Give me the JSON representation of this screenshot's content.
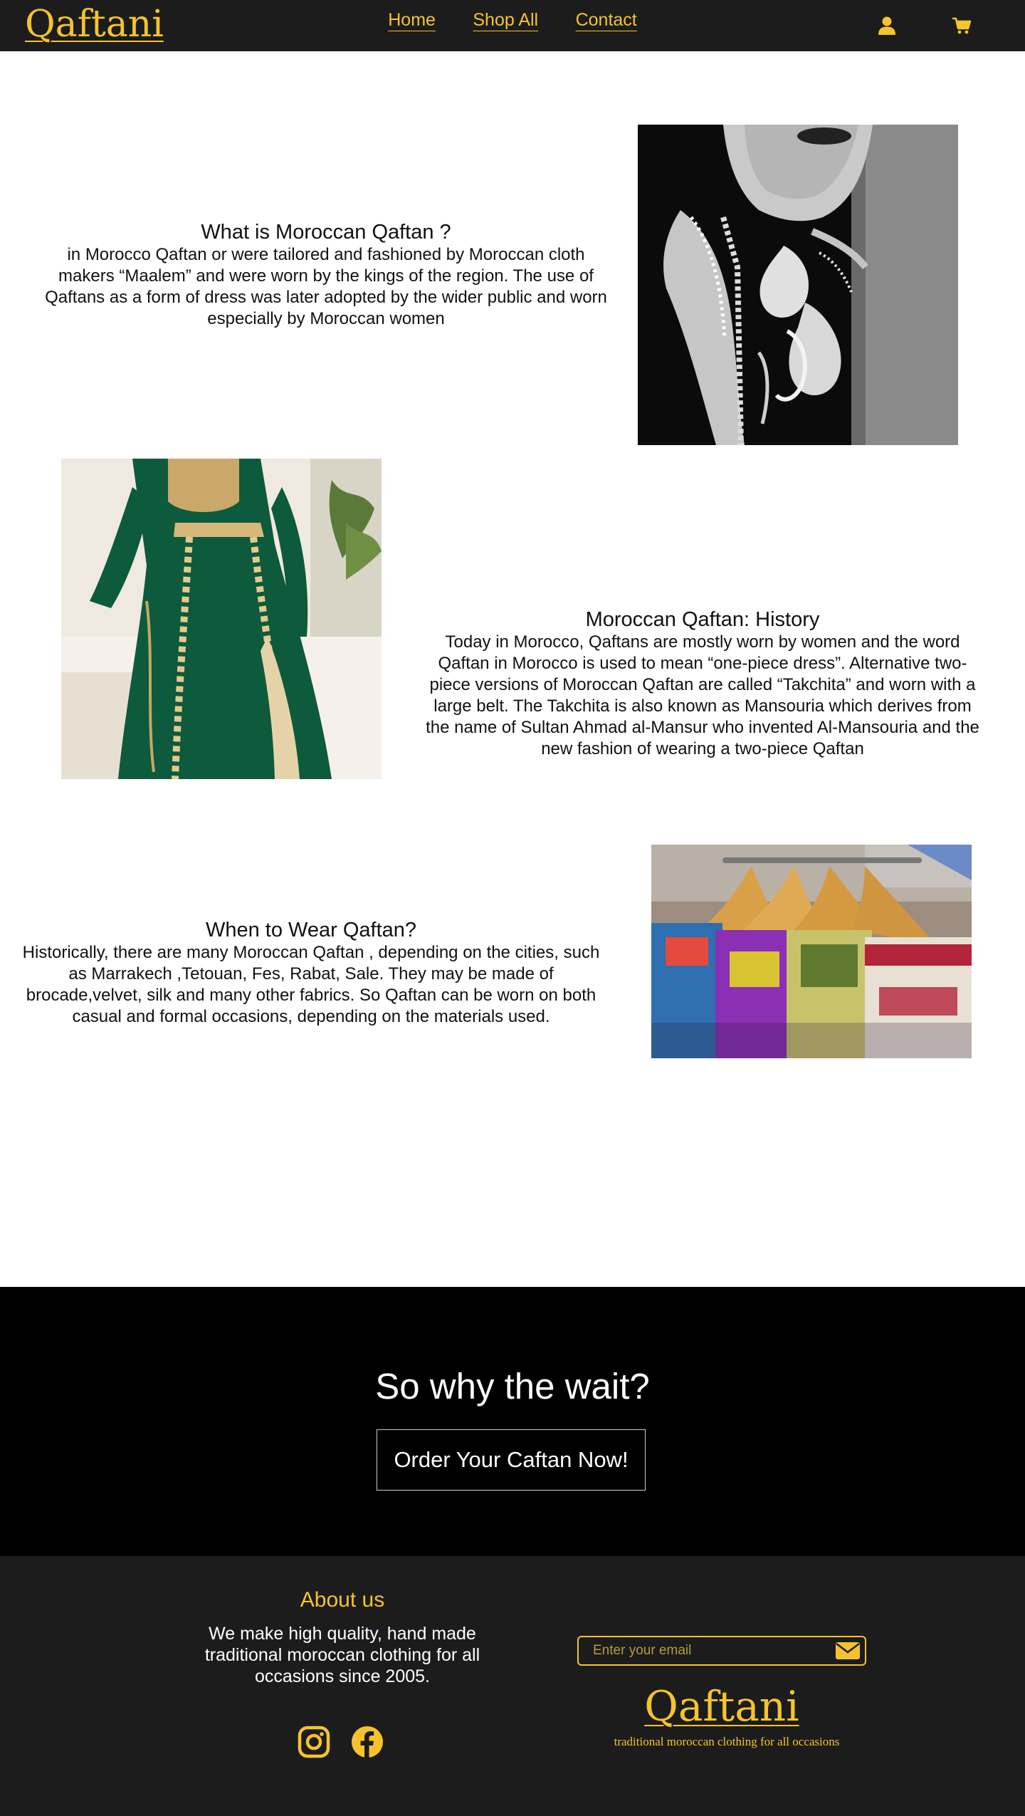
{
  "nav": {
    "brand": "Qaftani",
    "links": [
      "Home",
      "Shop All",
      "Contact"
    ],
    "icons": [
      "user-icon",
      "cart-icon"
    ]
  },
  "sections": [
    {
      "title": "What is Moroccan Qaftan ?",
      "text": "in Morocco Qaftan or were tailored and fashioned by Moroccan cloth makers “Maalem” and were worn by the kings of the region. The use of Qaftans as a form of dress was later adopted by the wider public and worn especially by Moroccan women"
    },
    {
      "title": "Moroccan Qaftan: History",
      "text": "Today in Morocco, Qaftans are mostly worn by women and the word Qaftan in Morocco is used to mean “one-piece dress”. Alternative two-piece versions of Moroccan Qaftan are called “Takchita” and worn with a large belt. The Takchita is also known as Mansouria which derives from the name of Sultan Ahmad al-Mansur who invented Al-Mansouria and the new fashion of wearing a two-piece Qaftan"
    },
    {
      "title": "When to Wear Qaftan?",
      "text": "Historically, there are many Moroccan Qaftan , depending on the cities, such as Marrakech ,Tetouan, Fes, Rabat, Sale. They may be made of brocade,velvet, silk and many other fabrics. So Qaftan can be worn on both casual and formal occasions, depending on the materials used."
    }
  ],
  "cta": {
    "title": "So why the wait?",
    "button": "Order Your Caftan Now!"
  },
  "footer": {
    "about_title": "About us",
    "about_text": "We make high quality, hand made traditional moroccan clothing for all occasions since 2005.",
    "email_placeholder": "Enter your email",
    "logo": "Qaftani",
    "tagline": "traditional moroccan clothing for all occasions",
    "social_icons": [
      "instagram-icon",
      "facebook-icon"
    ]
  },
  "colors": {
    "accent": "#f5c42c",
    "nav_bg": "#1c1c1c",
    "cta_bg": "#000000",
    "footer_bg": "#1c1c1c"
  }
}
